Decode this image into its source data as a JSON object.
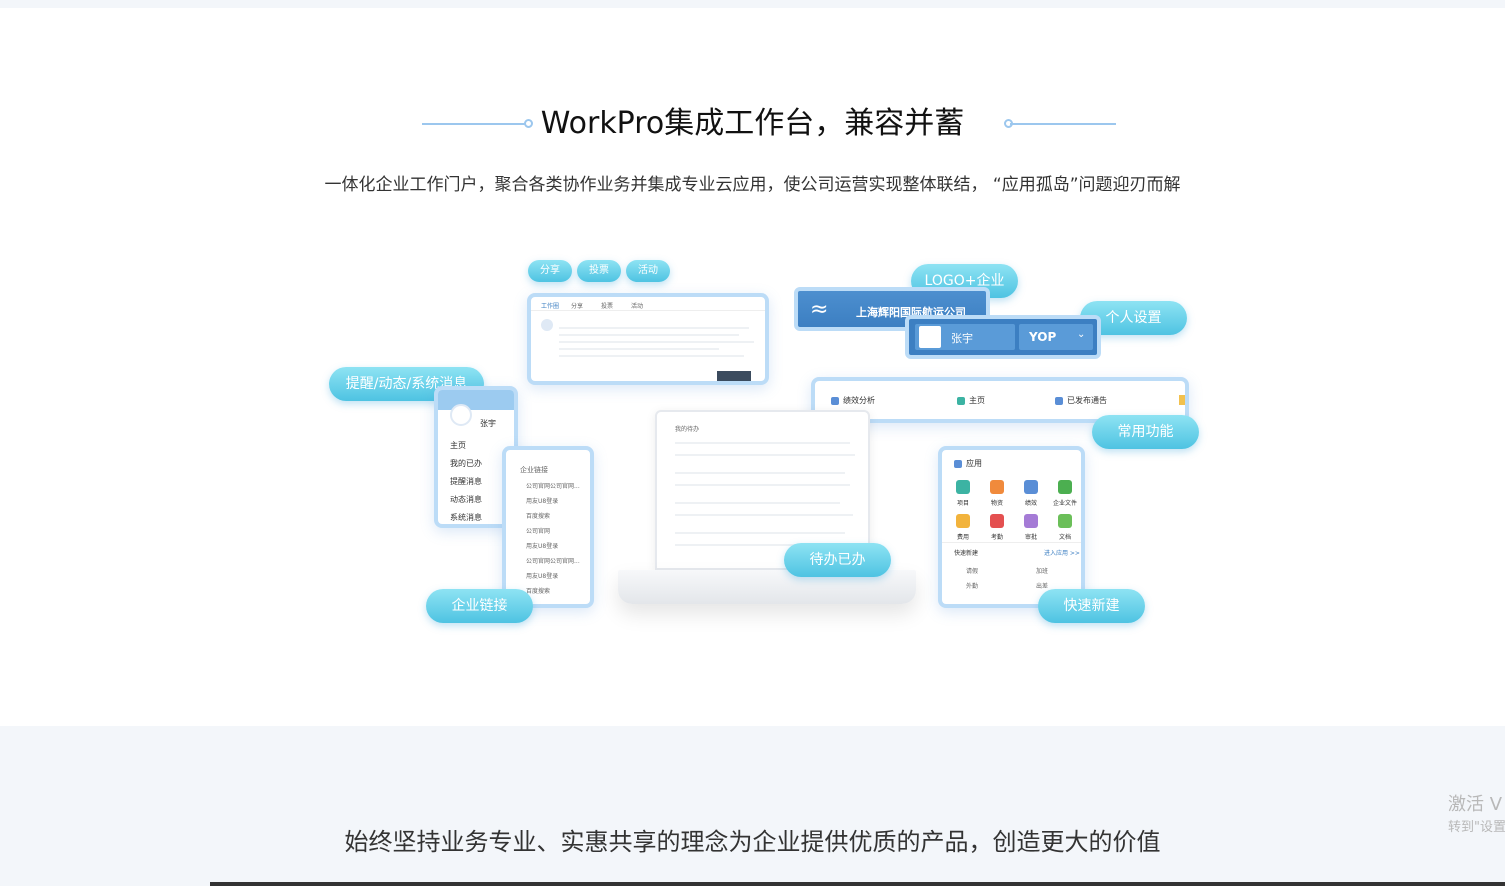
{
  "header": {
    "title": "WorkPro集成工作台，兼容并蓄",
    "subtitle": "一体化企业工作门户，聚合各类协作业务并集成专业云应用，使公司运营实现整体联结， “应用孤岛”问题迎刃而解"
  },
  "tags": {
    "share": "分享",
    "vote": "投票",
    "activity": "活动",
    "logo_company": "LOGO+企业",
    "personal": "个人设置",
    "reminders": "提醒/动态/系统消息",
    "common": "常用功能",
    "todo": "待办已办",
    "links": "企业链接",
    "quick": "快速新建"
  },
  "company": {
    "name": "上海辉阳国际航运公司",
    "user": "张宇",
    "brand": "YOP"
  },
  "toolbar": {
    "items": [
      "绩效分析",
      "主页",
      "已发布通告"
    ]
  },
  "feed_card": {
    "tabs": [
      "工作圈",
      "分享",
      "投票",
      "活动"
    ]
  },
  "phone": {
    "user": "张宇",
    "menu": [
      "主页",
      "我的已办",
      "提醒消息",
      "动态消息",
      "系统消息"
    ]
  },
  "links_card": {
    "title": "企业链接",
    "items": [
      "公司官网公司官网...",
      "用友U8登录",
      "百度搜索",
      "公司官网",
      "用友U8登录",
      "公司官网公司官网...",
      "用友U8登录",
      "百度搜索"
    ]
  },
  "apps_card": {
    "title": "应用",
    "apps": [
      "项目",
      "物资",
      "绩效",
      "企业文件",
      "费用",
      "考勤",
      "审批",
      "文档"
    ],
    "quick_title": "快速新建",
    "more": "进入应用 >>",
    "quick_items": [
      "请假",
      "加班",
      "外勤",
      "出差"
    ]
  },
  "laptop": {
    "title": "我的待办"
  },
  "footer": {
    "slogan": "始终坚持业务专业、实惠共享的理念为企业提供优质的产品，创造更大的价值"
  },
  "watermark": {
    "line1": "激活 V",
    "line2": "转到\"设置"
  },
  "colors": {
    "accent": "#4ec3e2",
    "border": "#bcdcf7",
    "navy": "#3c7fc2"
  }
}
